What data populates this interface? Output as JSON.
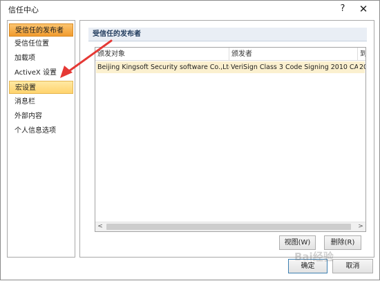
{
  "window": {
    "title": "信任中心",
    "help_glyph": "?",
    "close_glyph": "✕"
  },
  "nav": {
    "items": [
      {
        "label": "受信任的发布者",
        "state": "selected"
      },
      {
        "label": "受信任位置",
        "state": "normal"
      },
      {
        "label": "加载项",
        "state": "normal"
      },
      {
        "label": "ActiveX 设置",
        "state": "normal"
      },
      {
        "label": "宏设置",
        "state": "hover"
      },
      {
        "label": "消息栏",
        "state": "normal"
      },
      {
        "label": "外部内容",
        "state": "normal"
      },
      {
        "label": "个人信息选项",
        "state": "normal"
      }
    ]
  },
  "main": {
    "section_title": "受信任的发布者",
    "columns": [
      "颁发对象",
      "颁发者",
      "到"
    ],
    "rows": [
      [
        "Beijing Kingsoft Security software Co.,Ltd",
        "VeriSign Class 3 Code Signing 2010 CA",
        "20"
      ]
    ],
    "scroll_left_glyph": "<",
    "scroll_right_glyph": ">",
    "view_button": "视图(W)",
    "delete_button": "删除(R)"
  },
  "footer": {
    "ok_button": "确定",
    "cancel_button": "取消"
  },
  "watermark": "Bai经验",
  "colors": {
    "selected_nav": "#f19b2e",
    "hover_nav": "#ffd36d",
    "section_header": "#e9eef5",
    "selected_row": "#fbf0cf",
    "annotation_arrow": "#e53935"
  }
}
